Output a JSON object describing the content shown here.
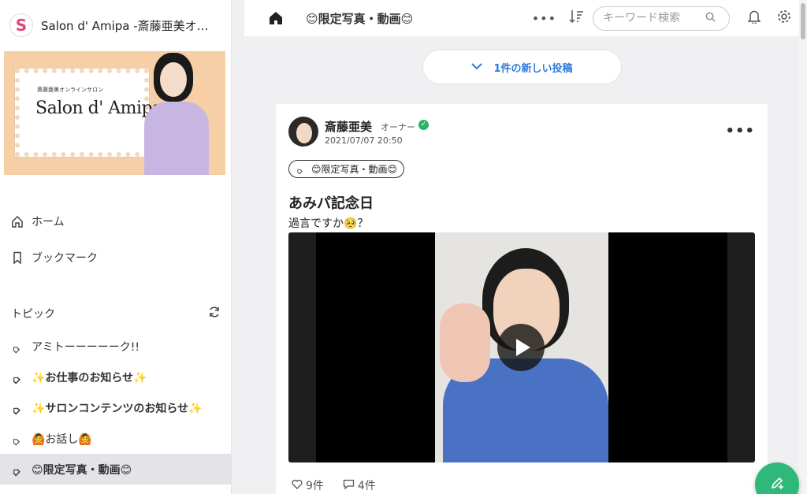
{
  "app": {
    "title": "Salon d' Amipa -斎藤亜美オ…",
    "logo_letter": "S"
  },
  "banner": {
    "subtitle": "斎藤亜美オンラインサロン",
    "name": "Salon d' Amipa"
  },
  "nav": [
    {
      "label": "ホーム",
      "icon": "home-outline-icon"
    },
    {
      "label": "ブックマーク",
      "icon": "bookmark-icon"
    }
  ],
  "topics": {
    "heading": "トピック",
    "items": [
      {
        "label": "アミトーーーーーク!!",
        "style": "normal"
      },
      {
        "label": "✨お仕事のお知らせ✨",
        "style": "bold"
      },
      {
        "label": "✨サロンコンテンツのお知らせ✨",
        "style": "bold"
      },
      {
        "label": "🙆お話し🙆",
        "style": "normal"
      },
      {
        "label": "😊限定写真・動画😊",
        "style": "active"
      }
    ]
  },
  "topbar": {
    "channel_title": "😊限定写真・動画😊",
    "search_placeholder": "キーワード検索"
  },
  "new_posts": {
    "label": "1件の新しい投稿"
  },
  "post": {
    "author": "斎藤亜美",
    "role": "オーナー",
    "timestamp": "2021/07/07 20:50",
    "topic_chip": "😊限定写真・動画😊",
    "title": "あみパ記念日",
    "body": "過言ですか🥺？",
    "likes": "9件",
    "comments": "4件"
  },
  "colors": {
    "accent_blue": "#2f7bd8",
    "fab_green": "#2eb87a",
    "verified_green": "#27b46b"
  }
}
